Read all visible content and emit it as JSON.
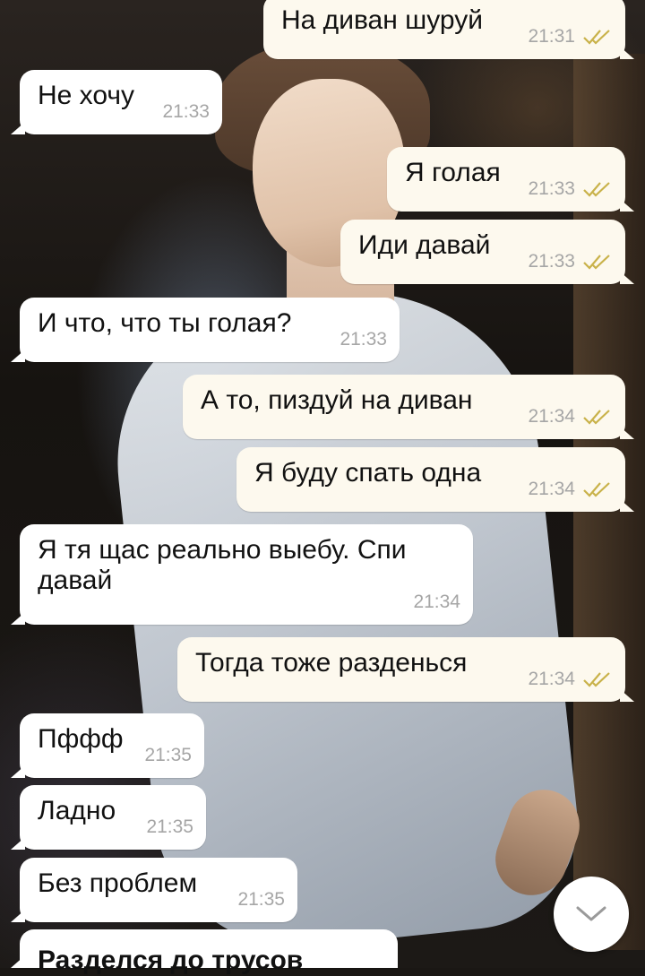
{
  "colors": {
    "incoming_bubble": "#ffffff",
    "outgoing_bubble": "#fdf9ee",
    "time_text": "#a6a6a6",
    "read_checks": "#c9b24a"
  },
  "messages": [
    {
      "direction": "out",
      "text": "На диван шуруй",
      "time": "21:31",
      "read": true
    },
    {
      "direction": "in",
      "text": "Не хочу",
      "time": "21:33"
    },
    {
      "direction": "out",
      "text": "Я голая",
      "time": "21:33",
      "read": true
    },
    {
      "direction": "out",
      "text": "Иди давай",
      "time": "21:33",
      "read": true
    },
    {
      "direction": "in",
      "text": "И что, что ты голая?",
      "time": "21:33"
    },
    {
      "direction": "out",
      "text": "А то, пиздуй на диван",
      "time": "21:34",
      "read": true
    },
    {
      "direction": "out",
      "text": "Я буду спать одна",
      "time": "21:34",
      "read": true
    },
    {
      "direction": "in",
      "text": "Я тя щас реально выебу. Спи давай",
      "time": "21:34"
    },
    {
      "direction": "out",
      "text": "Тогда тоже разденься",
      "time": "21:34",
      "read": true
    },
    {
      "direction": "in",
      "text": "Пффф",
      "time": "21:35"
    },
    {
      "direction": "in",
      "text": "Ладно",
      "time": "21:35"
    },
    {
      "direction": "in",
      "text": "Без проблем",
      "time": "21:35"
    },
    {
      "direction": "in",
      "text": "Разделся до трусов",
      "time": ""
    }
  ],
  "scroll_button": {
    "icon": "chevron-down-icon"
  }
}
